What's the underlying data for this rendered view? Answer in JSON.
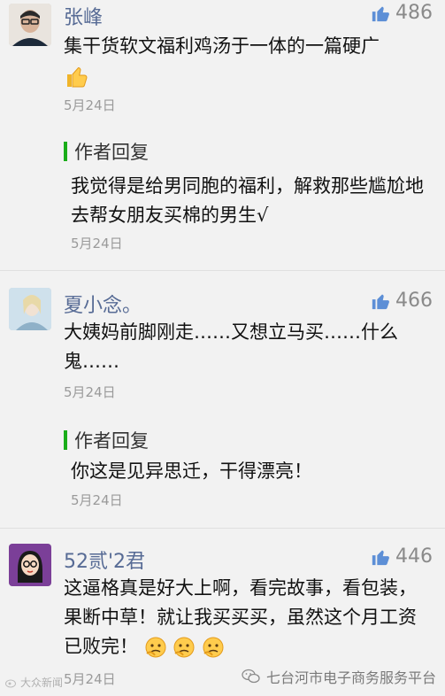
{
  "comments": [
    {
      "name": "张峰",
      "likes": "486",
      "text": "集干货软文福利鸡汤于一体的一篇硬广",
      "date": "5月24日",
      "reply_label": "作者回复",
      "reply_text": "我觉得是给男同胞的福利，解救那些尴尬地去帮女朋友买棉的男生√",
      "reply_date": "5月24日"
    },
    {
      "name": "夏小念。",
      "likes": "466",
      "text": "大姨妈前脚刚走……又想立马买……什么鬼……",
      "date": "5月24日",
      "reply_label": "作者回复",
      "reply_text": "你这是见异思迁，干得漂亮！",
      "reply_date": "5月24日"
    },
    {
      "name": "52贰'2君",
      "likes": "446",
      "text": "这逼格真是好大上啊，看完故事，看包装，果断中草！就让我买买买，虽然这个月工资已败完！",
      "date": "5月24日"
    }
  ],
  "footer": {
    "watermark": "大众新闻",
    "brand": "七台河市电子商务服务平台"
  },
  "colors": {
    "name": "#576b95",
    "reply_bar": "#1aad19",
    "like_icon": "#5d8fd6"
  }
}
